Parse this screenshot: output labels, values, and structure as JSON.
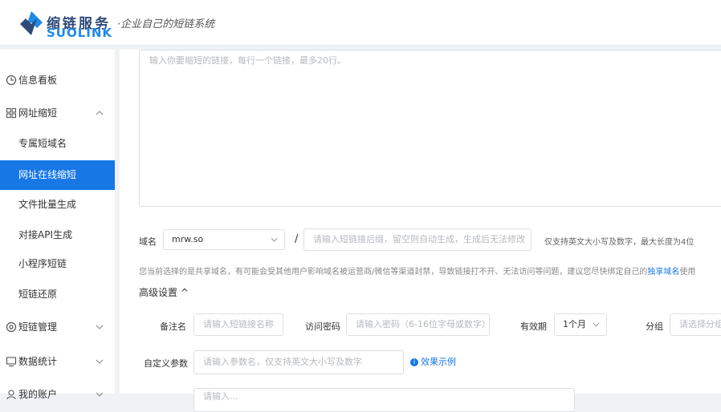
{
  "brand": {
    "name_cn": "缩链服务",
    "name_en": "SUOLINK",
    "slogan": "·企业自己的短链系统"
  },
  "sidebar": {
    "items": [
      {
        "label": "信息看板",
        "icon": "clock-icon"
      },
      {
        "label": "网址缩短",
        "icon": "grid-icon",
        "expanded": true,
        "children": [
          {
            "label": "专属短域名"
          },
          {
            "label": "网址在线缩短",
            "active": true
          },
          {
            "label": "文件批量生成"
          },
          {
            "label": "对接API生成"
          },
          {
            "label": "小程序短链"
          },
          {
            "label": "短链还原"
          }
        ]
      },
      {
        "label": "短链管理",
        "icon": "gear-icon"
      },
      {
        "label": "数据统计",
        "icon": "chart-icon"
      },
      {
        "label": "我的账户",
        "icon": "user-icon"
      }
    ]
  },
  "form": {
    "url_input_placeholder": "输入你要缩短的链接，每行一个链接，最多20行。",
    "domain_label": "域名",
    "domain_value": "mrw.so",
    "slash": "/",
    "suffix_placeholder": "请输入短链接后缀，留空则自动生成，生成后无法修改",
    "suffix_hint": "仅支持英文大小写及数字，最大长度为4位",
    "notice_text": "您当前选择的是共享域名，有可能会受其他用户影响域名被运营商/微信等渠道封禁，导致链接打不开、无法访问等问题，建议您尽快绑定自己的",
    "notice_link": "独享域名",
    "notice_tail": "使用",
    "advanced_title": "高级设置",
    "advanced_toggle": "^",
    "remark_label": "备注名",
    "remark_placeholder": "请输入短链接名称",
    "password_label": "访问密码",
    "password_placeholder": "请输入密码（6-16位字母或数字）",
    "validity_label": "有效期",
    "validity_value": "1个月",
    "group_label": "分组",
    "group_placeholder": "请选择分组",
    "params_label": "自定义参数",
    "params_placeholder": "请输入参数名，仅支持英文大小写及数字",
    "example_link": "效果示例",
    "next_field_placeholder": "请输入..."
  },
  "colors": {
    "accent": "#1677e5",
    "brand_dark": "#2f4a78"
  }
}
